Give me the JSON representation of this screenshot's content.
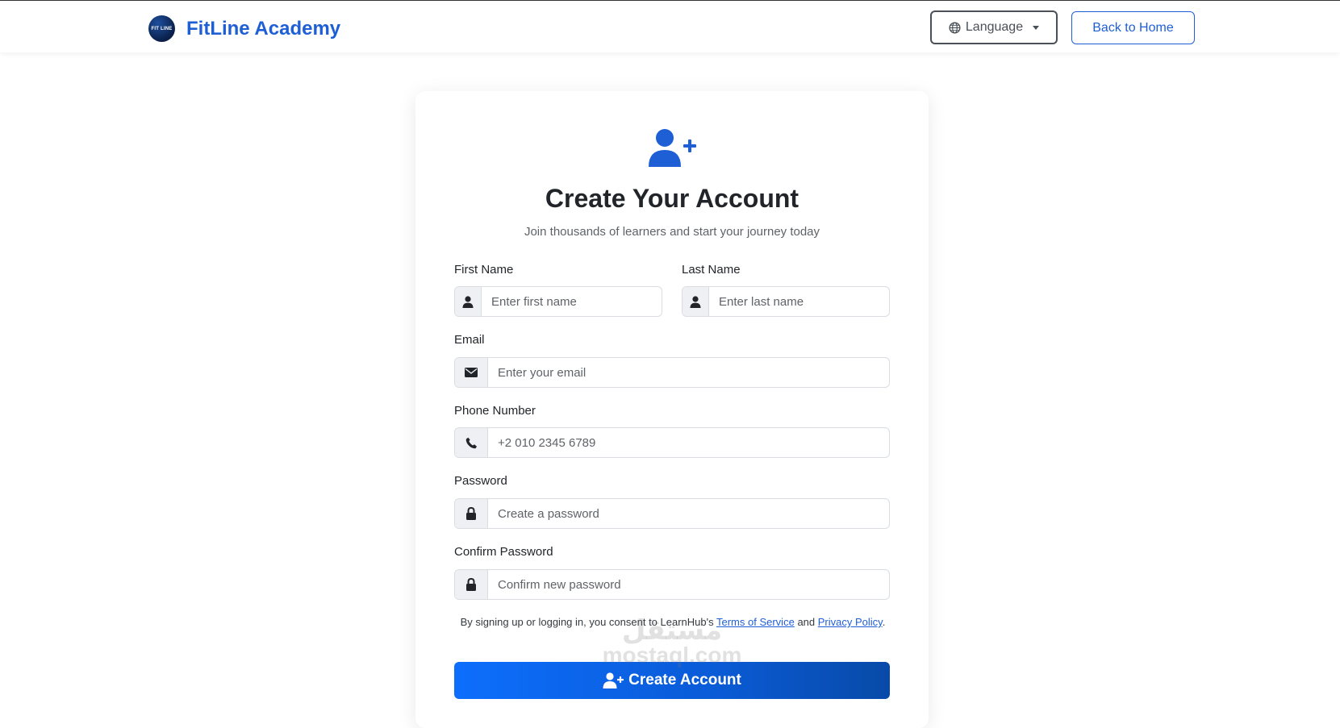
{
  "header": {
    "brand_name": "FitLine Academy",
    "logo_text": "FIT LINE",
    "language_label": "Language",
    "back_home_label": "Back to Home"
  },
  "form": {
    "title": "Create Your Account",
    "subtitle": "Join thousands of learners and start your journey today",
    "first_name_label": "First Name",
    "first_name_placeholder": "Enter first name",
    "last_name_label": "Last Name",
    "last_name_placeholder": "Enter last name",
    "email_label": "Email",
    "email_placeholder": "Enter your email",
    "phone_label": "Phone Number",
    "phone_placeholder": "+2 010 2345 6789",
    "password_label": "Password",
    "password_placeholder": "Create a password",
    "confirm_label": "Confirm Password",
    "confirm_placeholder": "Confirm new password",
    "terms_prefix": "By signing up or logging in, you consent to LearnHub's",
    "terms_link": "Terms of Service",
    "terms_and": "and",
    "privacy_link": "Privacy Policy",
    "terms_suffix": ".",
    "submit_label": "Create Account"
  },
  "watermark": {
    "line1": "مستقل",
    "line2": "mostaql.com"
  },
  "icons": {
    "hero": "user-plus-icon",
    "language": "globe-icon",
    "name": "user-icon",
    "email": "envelope-icon",
    "phone": "phone-icon",
    "password": "lock-icon"
  },
  "colors": {
    "brand": "#1f5fd6",
    "primary_button": "#0d6efd"
  }
}
